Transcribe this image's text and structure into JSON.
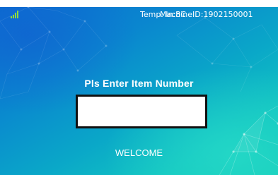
{
  "status_bar": {
    "signal_icon": "signal-strength-icon",
    "temperature_label": "Temp. In:8C",
    "machine_id_label": "MachineID:1902150001"
  },
  "main": {
    "prompt": "Pls Enter Item Number",
    "item_number_value": "",
    "welcome": "WELCOME"
  },
  "colors": {
    "background_blue": "#0a6fd0",
    "background_teal": "#16cdbb",
    "text": "#ffffff",
    "input_border": "#111111",
    "input_background": "#ffffff",
    "signal_icon": "#8fdc3a"
  }
}
